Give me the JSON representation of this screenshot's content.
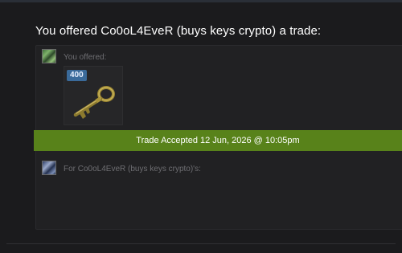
{
  "trade": {
    "heading": "You offered Co0oL4EveR (buys keys crypto) a trade:",
    "you_offered_label": "You offered:",
    "item": {
      "name": "key",
      "quantity": "400",
      "icon": "key-icon"
    },
    "status_banner": "Trade Accepted 12 Jun, 2026 @ 10:05pm",
    "for_label": "For Co0oL4EveR (buys keys crypto)'s:"
  },
  "colors": {
    "background": "#1b1b1d",
    "panel": "#212123",
    "accepted_banner": "#58821a",
    "quantity_badge": "#3a6a9a"
  }
}
